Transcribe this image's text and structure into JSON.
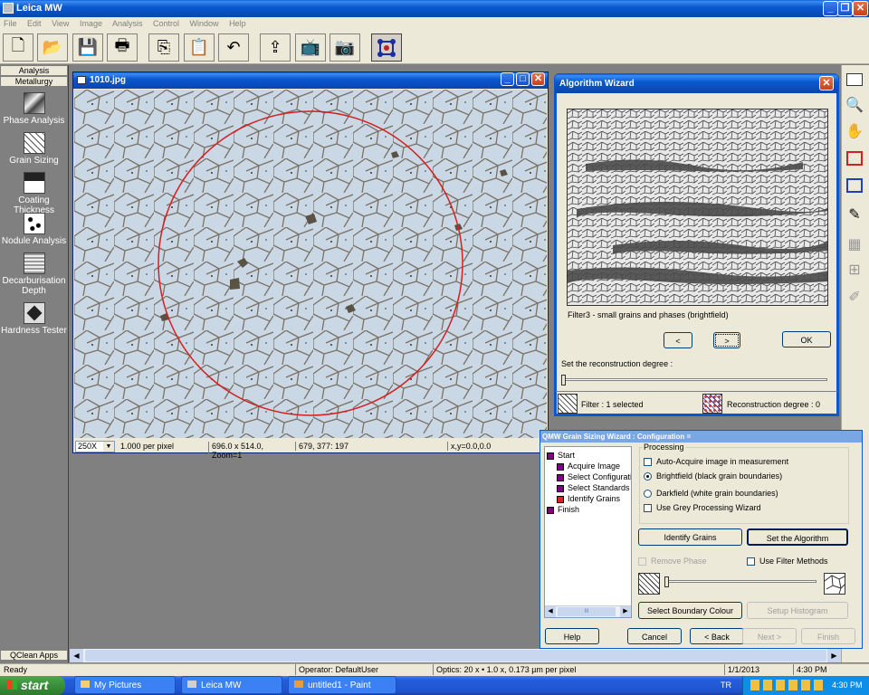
{
  "app": {
    "title": "Leica MW",
    "menu": [
      "File",
      "Edit",
      "View",
      "Image",
      "Analysis",
      "Control",
      "Window",
      "Help"
    ]
  },
  "toolbar": [
    "new-icon",
    "open-icon",
    "save-icon",
    "print-icon",
    "copy-icon",
    "paste-icon",
    "undo-icon",
    "export-icon",
    "tv-icon",
    "camera-icon",
    "grid-icon"
  ],
  "sidebar": {
    "tab1": "Analysis",
    "tab2": "Metallurgy",
    "items": [
      {
        "label": "Phase Analysis"
      },
      {
        "label": "Grain Sizing"
      },
      {
        "label": "Coating Thickness"
      },
      {
        "label": "Nodule Analysis"
      },
      {
        "label": "Decarburisation Depth"
      },
      {
        "label": "Hardness Tester"
      }
    ],
    "bottom": "QClean Apps"
  },
  "image_window": {
    "title": "1010.jpg",
    "zoom_select": "250X",
    "per_pixel": "1.000  per pixel",
    "size_info": "696.0 x 514.0, Zoom=1",
    "coords": "679, 377: 197",
    "xy": "x,y=0.0,0.0"
  },
  "wizard": {
    "title": "Algorithm Wizard",
    "caption": "Filter3 - small grains and phases (brightfield)",
    "prev": "<",
    "next": ">",
    "ok": "OK",
    "recon_label": "Set the reconstruction degree :",
    "filter_status": "Filter : 1 selected",
    "recon_status": "Reconstruction degree : 0"
  },
  "config": {
    "title": "QMW Grain Sizing Wizard : Configuration =",
    "tree": [
      {
        "label": "Start",
        "level": 0
      },
      {
        "label": "Acquire Image",
        "level": 1
      },
      {
        "label": "Select Configuratio",
        "level": 1
      },
      {
        "label": "Select Standards",
        "level": 1
      },
      {
        "label": "Identify Grains",
        "level": 1
      },
      {
        "label": "Finish",
        "level": 0
      }
    ],
    "scroll_mark": "III",
    "processing": "Processing",
    "opt_auto": "Auto-Acquire image in measurement",
    "opt_bright": "Brightfield (black grain boundaries)",
    "opt_dark": "Darkfield (white grain boundaries)",
    "opt_grey": "Use Grey Processing Wizard",
    "identify_btn": "Identify Grains",
    "algo_btn": "Set the Algorithm",
    "remove_phase": "Remove Phase",
    "use_filter": "Use Filter Methods",
    "boundary_btn": "Select Boundary Colour",
    "histogram_btn": "Setup Histogram",
    "help": "Help",
    "cancel": "Cancel",
    "back": "< Back",
    "next_btn": "Next >",
    "finish": "Finish"
  },
  "status": {
    "ready": "Ready",
    "operator": "Operator: DefaultUser",
    "optics": "Optics: 20 x • 1.0 x, 0.173 µm per pixel",
    "date": "1/1/2013",
    "time": "4:30 PM"
  },
  "taskbar": {
    "start": "start",
    "tasks": [
      "My Pictures",
      "Leica MW",
      "untitled1 - Paint"
    ],
    "lang": "TR",
    "clock": "4:30 PM"
  }
}
